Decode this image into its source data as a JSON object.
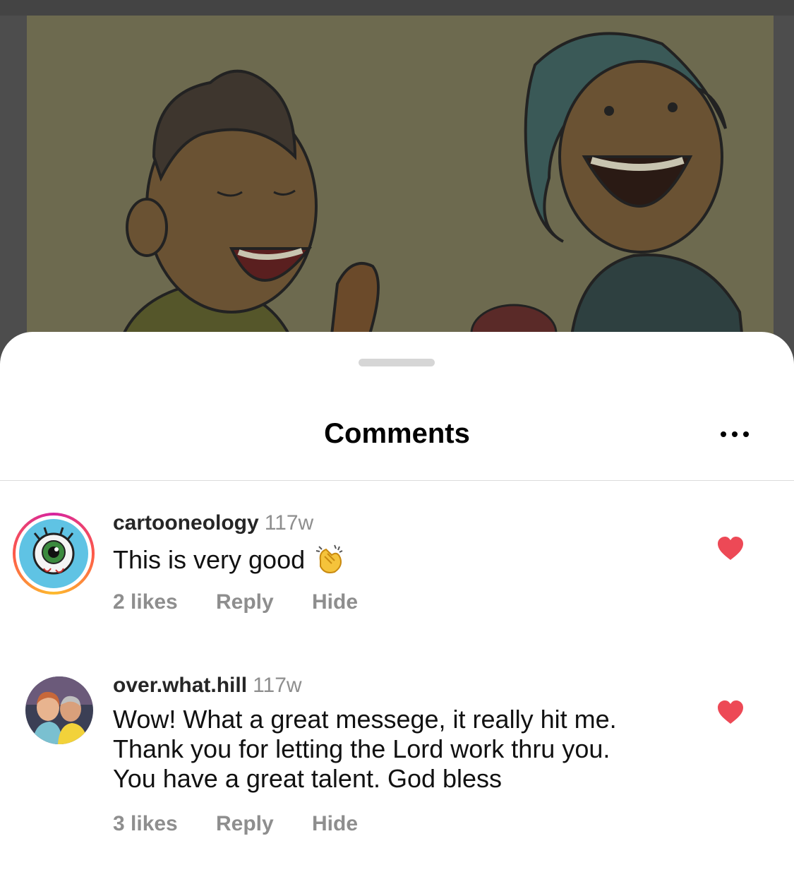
{
  "sheet": {
    "title": "Comments",
    "more_icon": "more-horizontal-icon"
  },
  "comments": [
    {
      "username": "cartooneology",
      "age": "117w",
      "text_lines": [
        "This is very good"
      ],
      "emoji": "clapping-hands-emoji",
      "likes": "2 likes",
      "reply": "Reply",
      "hide": "Hide",
      "liked": true,
      "has_story_ring": true
    },
    {
      "username": "over.what.hill",
      "age": "117w",
      "text_lines": [
        "Wow! What a great messege, it really hit me.",
        "Thank you for letting the Lord work thru you.",
        "You have a great talent. God bless"
      ],
      "likes": "3 likes",
      "reply": "Reply",
      "hide": "Hide",
      "liked": true,
      "has_story_ring": false
    }
  ],
  "colors": {
    "heart": "#ed4956",
    "meta_gray": "#8e8e8e",
    "overlay_dim": "#4d4d4d"
  }
}
